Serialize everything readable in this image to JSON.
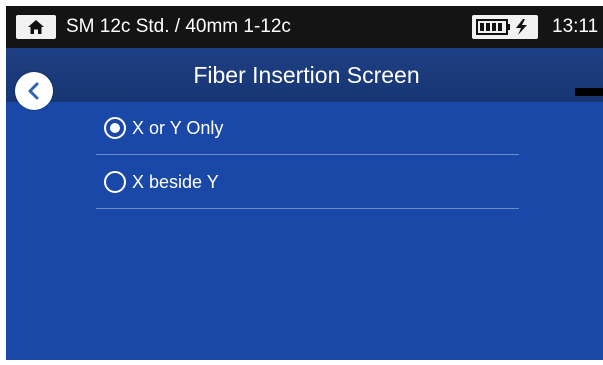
{
  "status_bar": {
    "title": "SM 12c Std. / 40mm 1-12c",
    "time": "13:11",
    "home_icon": "home-icon",
    "battery_icon": "battery-charging-icon"
  },
  "header": {
    "title": "Fiber Insertion Screen",
    "back_icon": "chevron-left-icon"
  },
  "options": [
    {
      "label": "X or Y Only",
      "selected": true
    },
    {
      "label": "X beside Y",
      "selected": false
    }
  ],
  "colors": {
    "background": "#1a48a8",
    "status_bar": "#141414",
    "title_bar": "#1e3f84",
    "accent": "#2060c0"
  }
}
